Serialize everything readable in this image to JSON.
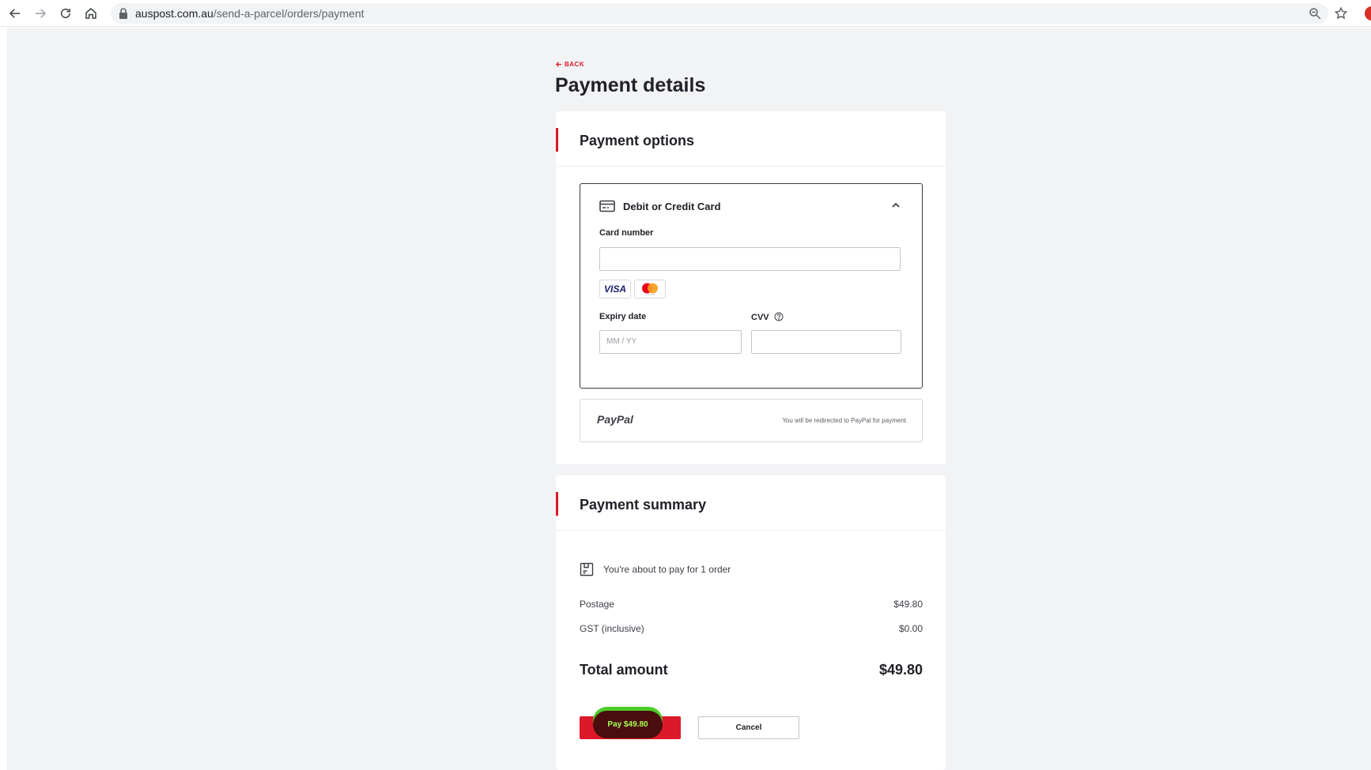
{
  "browser": {
    "url_domain": "auspost.com.au",
    "url_path": "/send-a-parcel/orders/payment"
  },
  "page": {
    "back_label": "BACK",
    "title": "Payment details"
  },
  "payment_options": {
    "title": "Payment options",
    "card": {
      "title": "Debit or Credit Card",
      "card_number_label": "Card number",
      "card_number_value": "",
      "brands": [
        "VISA",
        "Mastercard"
      ],
      "expiry_label": "Expiry date",
      "expiry_placeholder": "MM / YY",
      "cvv_label": "CVV",
      "cvv_value": ""
    },
    "paypal": {
      "name": "PayPal",
      "note": "You will be redirected to PayPal for payment"
    }
  },
  "summary": {
    "title": "Payment summary",
    "order_text": "You're about to pay for 1 order",
    "rows": [
      {
        "label": "Postage",
        "value": "$49.80"
      },
      {
        "label": "GST (inclusive)",
        "value": "$0.00"
      }
    ],
    "total_label": "Total amount",
    "total_value": "$49.80",
    "pay_label": "Pay $49.80",
    "cancel_label": "Cancel"
  },
  "colors": {
    "accent": "#dc1928",
    "highlight": "#4ccc28"
  },
  "icons": [
    "back-arrow-icon",
    "forward-arrow-icon",
    "reload-icon",
    "home-icon",
    "lock-icon",
    "zoom-icon",
    "star-icon",
    "card-icon",
    "chevron-up-icon",
    "info-icon",
    "order-icon"
  ]
}
